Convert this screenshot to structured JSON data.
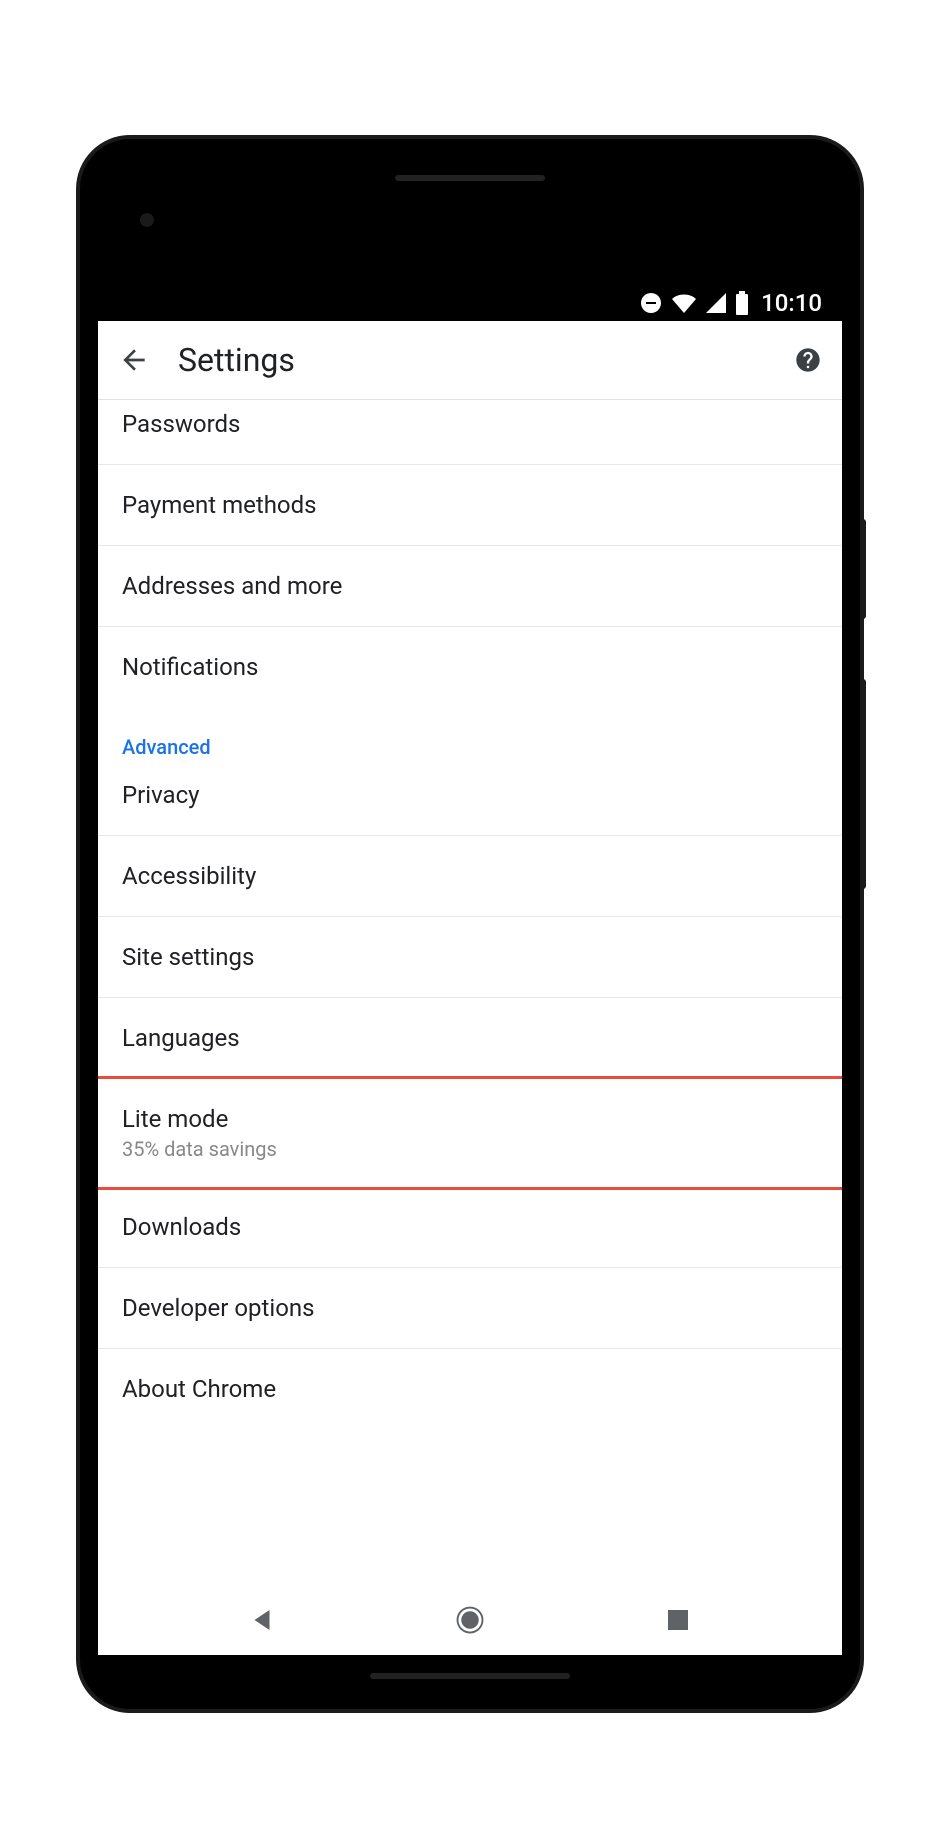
{
  "status": {
    "time": "10:10"
  },
  "header": {
    "title": "Settings"
  },
  "items": {
    "passwords": "Passwords",
    "payment": "Payment methods",
    "addresses": "Addresses and more",
    "notifications": "Notifications",
    "advanced_header": "Advanced",
    "privacy": "Privacy",
    "accessibility": "Accessibility",
    "site_settings": "Site settings",
    "languages": "Languages",
    "lite_mode": "Lite mode",
    "lite_mode_sub": "35% data savings",
    "downloads": "Downloads",
    "developer": "Developer options",
    "about": "About Chrome"
  }
}
